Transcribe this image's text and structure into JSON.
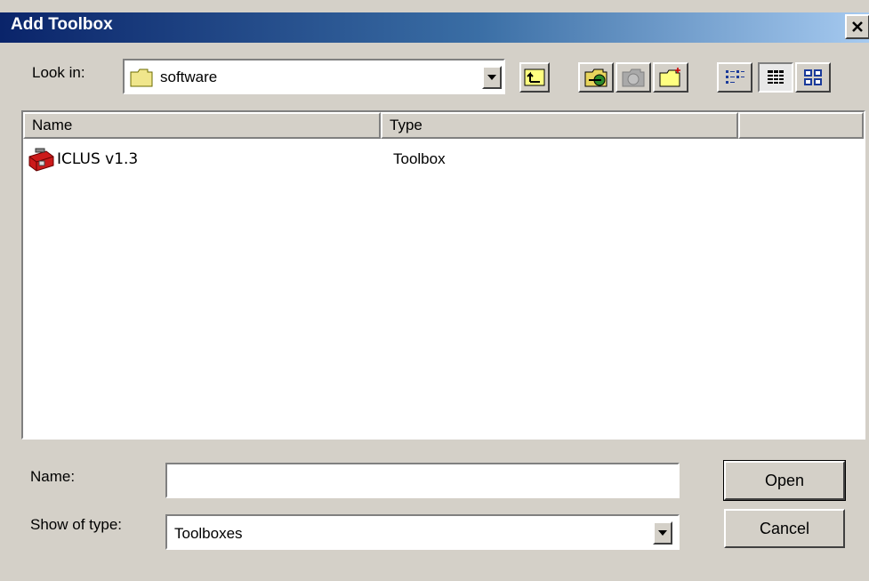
{
  "window": {
    "title": "Add Toolbox"
  },
  "look_in": {
    "label": "Look in:",
    "value": "software"
  },
  "columns": [
    "Name",
    "Type",
    ""
  ],
  "files": [
    {
      "name": "ICLUS v1.3",
      "type": "Toolbox"
    }
  ],
  "name_field": {
    "label": "Name:",
    "value": ""
  },
  "type_field": {
    "label": "Show of type:",
    "value": "Toolboxes"
  },
  "buttons": {
    "open": "Open",
    "cancel": "Cancel"
  },
  "icons": [
    "folder-icon",
    "up-folder-icon",
    "connect-folder-icon",
    "disconnect-folder-icon",
    "new-folder-icon",
    "list-view-icon",
    "details-view-icon",
    "thumbnails-view-icon",
    "toolbox-icon",
    "close-icon",
    "dropdown-arrow-icon"
  ],
  "colors": {
    "title_start": "#0a246a",
    "title_end": "#a6caf0",
    "face": "#d4d0c8"
  }
}
